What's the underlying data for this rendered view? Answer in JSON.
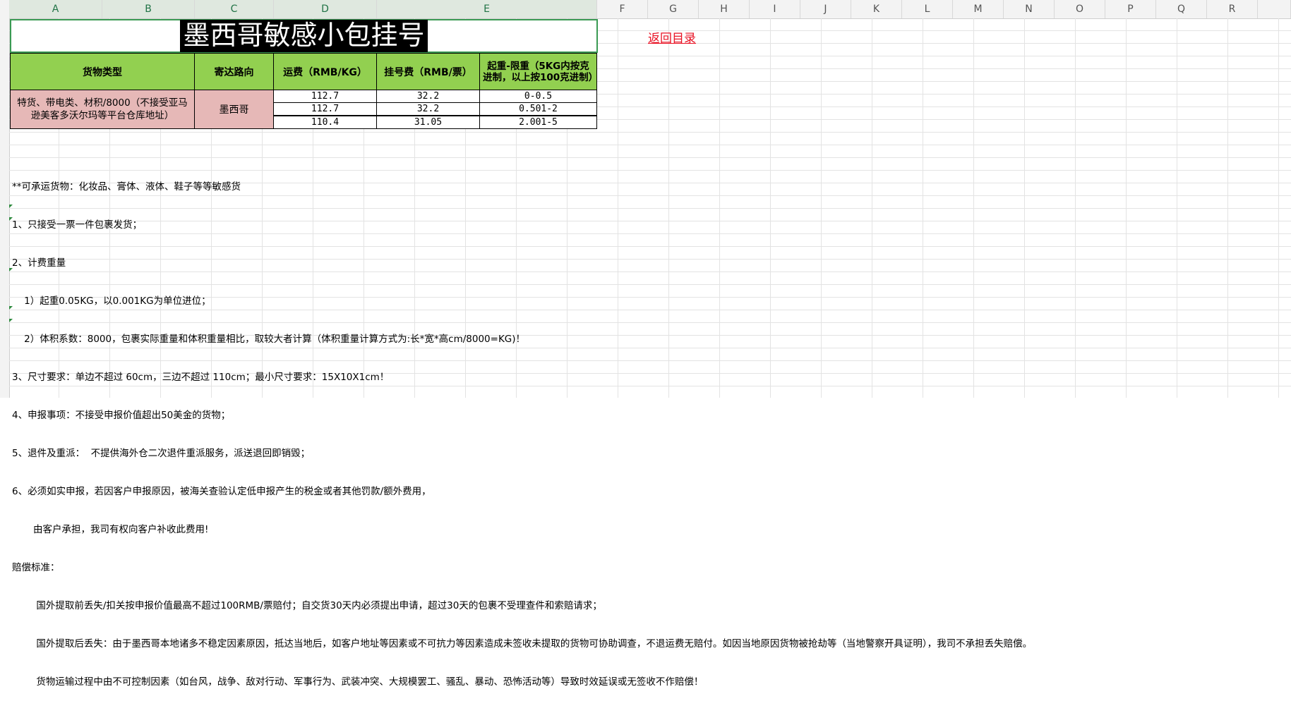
{
  "columns": [
    "A",
    "B",
    "C",
    "D",
    "E",
    "F",
    "G",
    "H",
    "I",
    "J",
    "K",
    "L",
    "M",
    "N",
    "O",
    "P",
    "Q",
    "R"
  ],
  "title": "墨西哥敏感小包挂号",
  "back_link": "返回目录",
  "table": {
    "headers": [
      "货物类型",
      "寄达路向",
      "运费（RMB/KG）",
      "挂号费（RMB/票）",
      "起重-限重（5KG内按克进制，以上按100克进制）"
    ],
    "cargo_type": "特货、带电类、材积/8000（不接受亚马逊美客多沃尔玛等平台仓库地址）",
    "destination": "墨西哥",
    "rows": [
      {
        "freight": "112.7",
        "reg_fee": "32.2",
        "weight": "0-0.5"
      },
      {
        "freight": "112.7",
        "reg_fee": "32.2",
        "weight": "0.501-2"
      },
      {
        "freight": "110.4",
        "reg_fee": "31.05",
        "weight": "2.001-5"
      }
    ]
  },
  "notes": [
    "**可承运货物：化妆品、膏体、液体、鞋子等等敏感货",
    "1、只接受一票一件包裹发货；",
    "2、计费重量",
    "    1）起重0.05KG，以0.001KG为单位进位；",
    "    2）体积系数：8000，包裹实际重量和体积重量相比，取较大者计算（体积重量计算方式为:长*宽*高cm/8000=KG)！",
    "3、尺寸要求：单边不超过 60cm，三边不超过 110cm；最小尺寸要求：15X10X1cm！",
    "4、申报事项：不接受申报价值超出50美金的货物；",
    "5、退件及重派：  不提供海外仓二次退件重派服务，派送退回即销毁；",
    "6、必须如实申报，若因客户申报原因，被海关查验认定低申报产生的税金或者其他罚款/额外费用，",
    "       由客户承担，我司有权向客户补收此费用!",
    "赔偿标准：",
    "        国外提取前丢失/扣关按申报价值最高不超过100RMB/票赔付；自交货30天内必须提出申请，超过30天的包裹不受理查件和索赔请求；",
    "        国外提取后丢失：由于墨西哥本地诸多不稳定因素原因，抵达当地后，如客户地址等因素或不可抗力等因素造成未签收未提取的货物可协助调查，不退运费无赔付。如因当地原因货物被抢劫等（当地警察开具证明），我司不承担丢失赔偿。",
    "        货物运输过程中由不可控制因素（如台风，战争、敌对行动、军事行为、武装冲突、大规模罢工、骚乱、暴动、恐怖活动等）导致时效延误或无签收不作赔偿！"
  ],
  "colors": {
    "header_green": "#92d050",
    "pink": "#e6b8b7",
    "link_red": "#e81123"
  }
}
